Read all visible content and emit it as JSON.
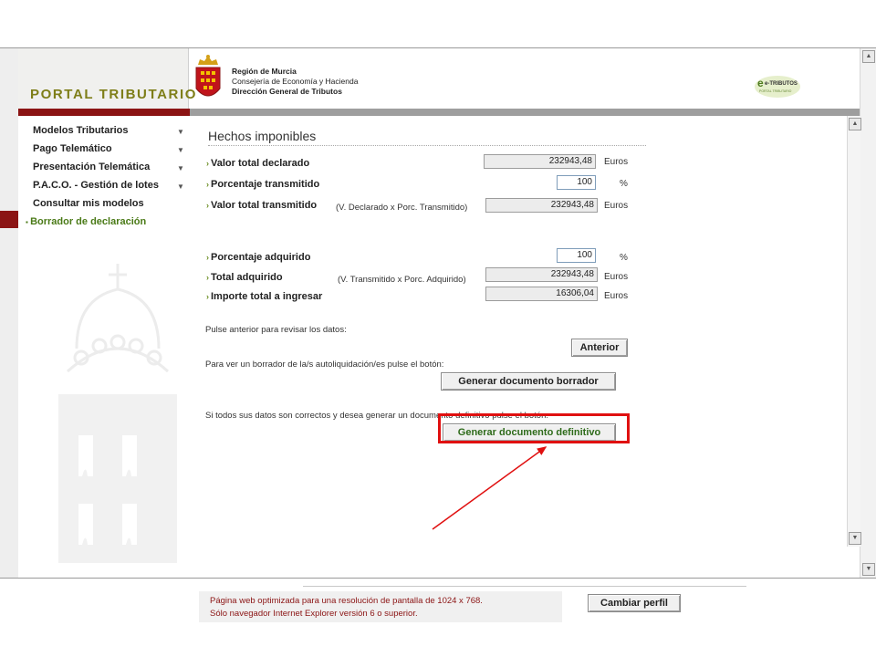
{
  "header": {
    "portal_title": "PORTAL TRIBUTARIO",
    "org_lines": [
      "Región de Murcia",
      "Consejería de Economía y Hacienda",
      "Dirección General de Tributos"
    ],
    "logo_text": "e-TRIBUTOS",
    "logo_sub": "PORTAL TRIBUTARIO"
  },
  "sidebar": {
    "items": [
      {
        "label": "Modelos Tributarios",
        "icon": "chevron-down-icon"
      },
      {
        "label": "Pago Telemático",
        "icon": "chevron-down-icon"
      },
      {
        "label": "Presentación Telemática",
        "icon": "chevron-down-icon"
      },
      {
        "label": "P.A.C.O. - Gestión de lotes",
        "icon": "chevron-down-icon"
      },
      {
        "label": "Consultar mis modelos"
      },
      {
        "label": "Borrador de declaración",
        "active": true
      }
    ]
  },
  "form": {
    "title": "Hechos imponibles",
    "rows": [
      {
        "label": "Valor total declarado",
        "note": "",
        "value": "232943,48",
        "unit": "Euros",
        "readonly": true
      },
      {
        "label": "Porcentaje transmitido",
        "note": "",
        "value": "100",
        "unit": "%",
        "readonly": false
      },
      {
        "label": "Valor total transmitido",
        "note": "(V. Declarado x Porc. Transmitido)",
        "value": "232943,48",
        "unit": "Euros",
        "readonly": true
      },
      {
        "label": "Porcentaje adquirido",
        "note": "",
        "value": "100",
        "unit": "%",
        "readonly": false
      },
      {
        "label": "Total adquirido",
        "note": "(V. Transmitido x Porc. Adquirido)",
        "value": "232943,48",
        "unit": "Euros",
        "readonly": true
      },
      {
        "label": "Importe total a ingresar",
        "note": "",
        "value": "16306,04",
        "unit": "Euros",
        "readonly": true
      }
    ]
  },
  "instructions": {
    "review_text": "Pulse anterior para revisar los datos:",
    "draft_text": "Para ver un borrador de la/s autoliquidación/es pulse el botón:",
    "final_text": "Si todos sus datos son correctos y desea generar un documento definitivo pulse el botón:"
  },
  "buttons": {
    "anterior": "Anterior",
    "generate_draft": "Generar documento borrador",
    "generate_final": "Generar documento definitivo",
    "change_profile": "Cambiar perfil"
  },
  "footer": {
    "line1": "Página web optimizada para una resolución de pantalla de 1024 x 768.",
    "line2": "Sólo navegador Internet Explorer versión 6 o superior."
  },
  "annotation": {
    "highlight_color": "#e01010"
  },
  "colors": {
    "brand_red": "#8b1414",
    "brand_olive": "#7e7e18",
    "active_green": "#4a7a17"
  }
}
